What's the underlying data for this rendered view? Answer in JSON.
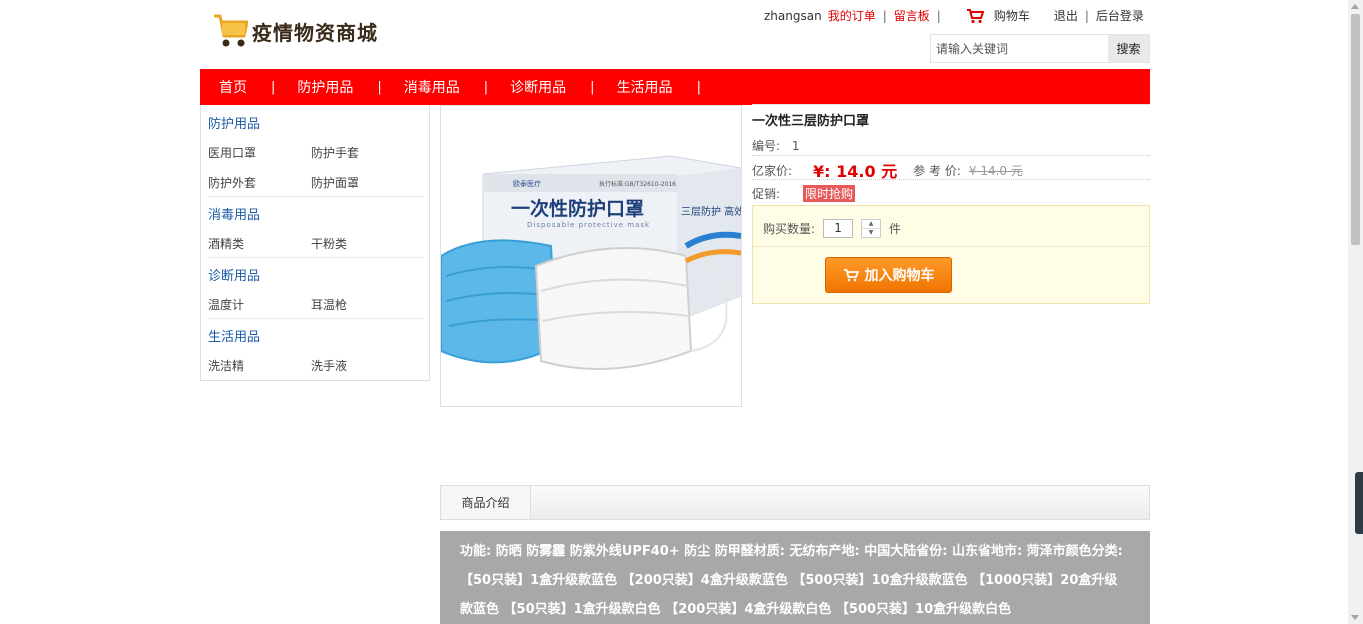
{
  "header": {
    "logo_text": "疫情物资商城",
    "username": "zhangsan",
    "my_orders": "我的订单",
    "message_board": "留言板",
    "separator": "|",
    "cart": "购物车",
    "logout": "退出",
    "admin_login": "后台登录",
    "search_placeholder": "请输入关键词",
    "search_button": "搜索"
  },
  "nav": {
    "items": [
      "首页",
      "防护用品",
      "消毒用品",
      "诊断用品",
      "生活用品"
    ],
    "separator": "|"
  },
  "sidebar": {
    "categories": [
      {
        "name": "防护用品",
        "items": [
          "医用口罩",
          "防护手套",
          "防护外套",
          "防护面罩"
        ]
      },
      {
        "name": "消毒用品",
        "items": [
          "酒精类",
          "干粉类"
        ]
      },
      {
        "name": "诊断用品",
        "items": [
          "温度计",
          "耳温枪"
        ]
      },
      {
        "name": "生活用品",
        "items": [
          "洗洁精",
          "洗手液"
        ]
      }
    ]
  },
  "product": {
    "image_texts": {
      "brand": "欧泰医疗",
      "standard": "执行标准:GB/T32610-2016",
      "title": "一次性防护口罩",
      "subtitle": "Disposable protective mask",
      "side": "三层防护 高效过"
    },
    "title": "一次性三层防护口罩",
    "number_label": "编号:",
    "number_value": "1",
    "price_label": "亿家价:",
    "price_value": "¥: 14.0 元",
    "ref_label": "参 考 价:",
    "ref_value": "¥ 14.0 元",
    "promo_label": "促销:",
    "promo_value": "限时抢购",
    "qty_label": "购买数量:",
    "qty_value": "1",
    "qty_unit": "件",
    "add_cart": "加入购物车"
  },
  "tabs": {
    "intro": "商品介绍"
  },
  "description": "功能: 防晒 防雾霾 防紫外线UPF40+ 防尘 防甲醛材质: 无纺布产地: 中国大陆省份: 山东省地市: 菏泽市颜色分类: 【50只装】1盒升级款蓝色 【200只装】4盒升级款蓝色 【500只装】10盒升级款蓝色 【1000只装】20盒升级款蓝色 【50只装】1盒升级款白色 【200只装】4盒升级款白色 【500只装】10盒升级款白色",
  "colors": {
    "nav_bg": "#fe0000",
    "accent_red": "#e10000",
    "category_blue": "#1a5aa8",
    "button_orange": "#f07400",
    "buybox_bg": "#fffde6",
    "desc_bg": "#a9a8a8"
  },
  "icons": [
    "shopping-cart-logo-icon",
    "cart-icon",
    "spinner-up-icon",
    "spinner-down-icon",
    "add-cart-icon"
  ]
}
